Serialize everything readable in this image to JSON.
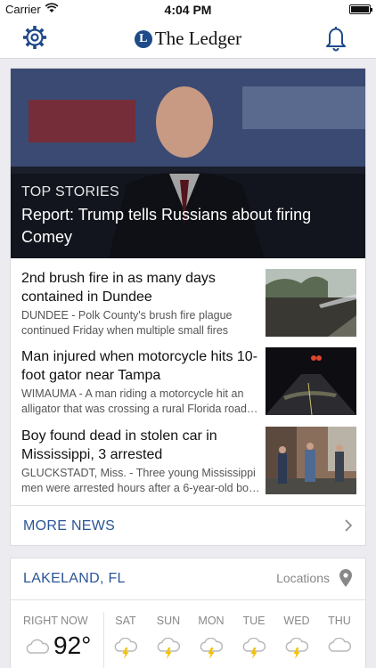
{
  "status_bar": {
    "carrier": "Carrier",
    "time": "4:04 PM"
  },
  "header": {
    "logo_mark": "L",
    "logo_name": "The Ledger",
    "icons": [
      "gear-icon",
      "bell-icon"
    ]
  },
  "top_story": {
    "kicker": "TOP STORIES",
    "headline": "Report: Trump tells Russians about firing Comey"
  },
  "stories": [
    {
      "title": "2nd brush fire in as many days contained in Dundee",
      "snippet": "DUNDEE - Polk County's brush fire plague continued Friday when multiple small fires were…"
    },
    {
      "title": "Man injured when motorcycle hits 10-foot gator near Tampa",
      "snippet": "WIMAUMA - A man riding a motorcycle hit an alligator that was crossing a rural Florida road…"
    },
    {
      "title": "Boy found dead in stolen car in Mississippi, 3 arrested",
      "snippet": "GLUCKSTADT, Miss. - Three young Mississippi men were arrested hours after a 6-year-old bo…"
    }
  ],
  "more_news": {
    "label": "MORE NEWS"
  },
  "weather": {
    "city": "LAKELAND, FL",
    "locations_label": "Locations",
    "now": {
      "label": "RIGHT NOW",
      "temp": "92°",
      "icon": "cloud-icon"
    },
    "forecast": [
      {
        "day": "SAT",
        "icon": "thunderstorm-icon"
      },
      {
        "day": "SUN",
        "icon": "thunderstorm-icon"
      },
      {
        "day": "MON",
        "icon": "thunderstorm-icon"
      },
      {
        "day": "TUE",
        "icon": "thunderstorm-icon"
      },
      {
        "day": "WED",
        "icon": "thunderstorm-icon"
      },
      {
        "day": "THU",
        "icon": "cloud-icon"
      }
    ]
  },
  "colors": {
    "accent": "#2a5597",
    "nav_icon": "#1f4a8a",
    "bolt": "#f2c200"
  }
}
